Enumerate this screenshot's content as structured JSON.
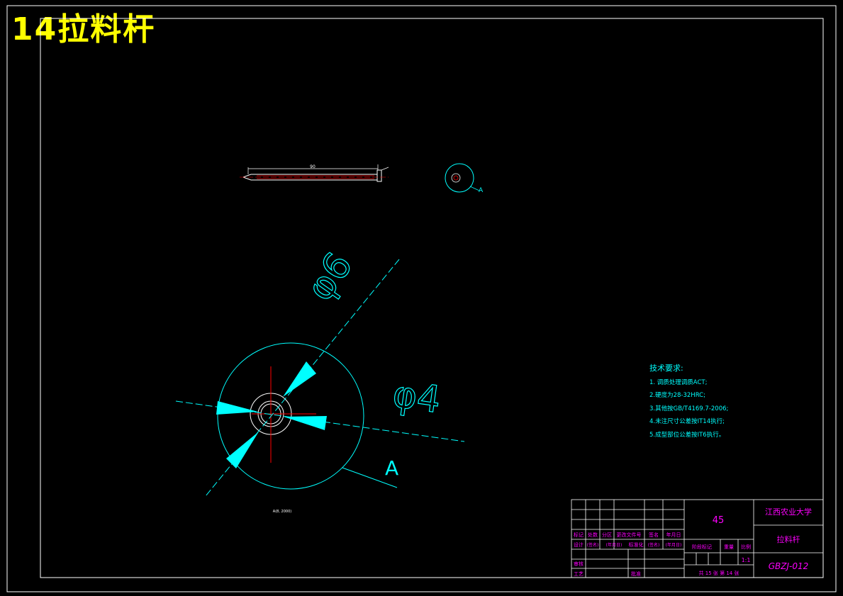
{
  "sheet": {
    "title": "14拉料杆",
    "colors": {
      "background": "#000000",
      "frame": "#ffffff",
      "geometry": "#00ffff",
      "centerline": "#ff0000",
      "text": "#ff00ff",
      "title": "#ffff00",
      "hatch": "#00ffff"
    }
  },
  "views": {
    "side_view_dim": "90",
    "end_view_label": "A",
    "detail_dim_large": "φ6",
    "detail_dim_small": "φ4",
    "detail_view_label": "A",
    "detail_scale_note": "A(8, 2000)"
  },
  "tech_requirements": {
    "heading": "技术要求:",
    "items": [
      "1. 调质处理调质ACT;",
      "2.硬度为28-32HRC;",
      "3.其他按GB/T4169.7-2006;",
      "4.未注尺寸公差按IT14执行;",
      "5.成型部位公差按IT6执行。"
    ]
  },
  "title_block": {
    "header_labels": [
      "标记",
      "处数",
      "分区",
      "更改文件号",
      "签名",
      "年月日"
    ],
    "design_row": [
      "设计",
      "(签名)",
      "(年月日)",
      "标准化",
      "(签名)",
      "(年月日)"
    ],
    "review_label": "审核",
    "process_label": "工艺",
    "approve_label": "批准",
    "material": "45",
    "stage_label": "阶段标记",
    "weight_label": "重量",
    "scale_label": "比例",
    "scale_value": "1:1",
    "sheets_text": "共 15 张  第 14 张",
    "school": "江西农业大学",
    "part_name": "拉料杆",
    "drawing_number": "GBZJ-012"
  }
}
